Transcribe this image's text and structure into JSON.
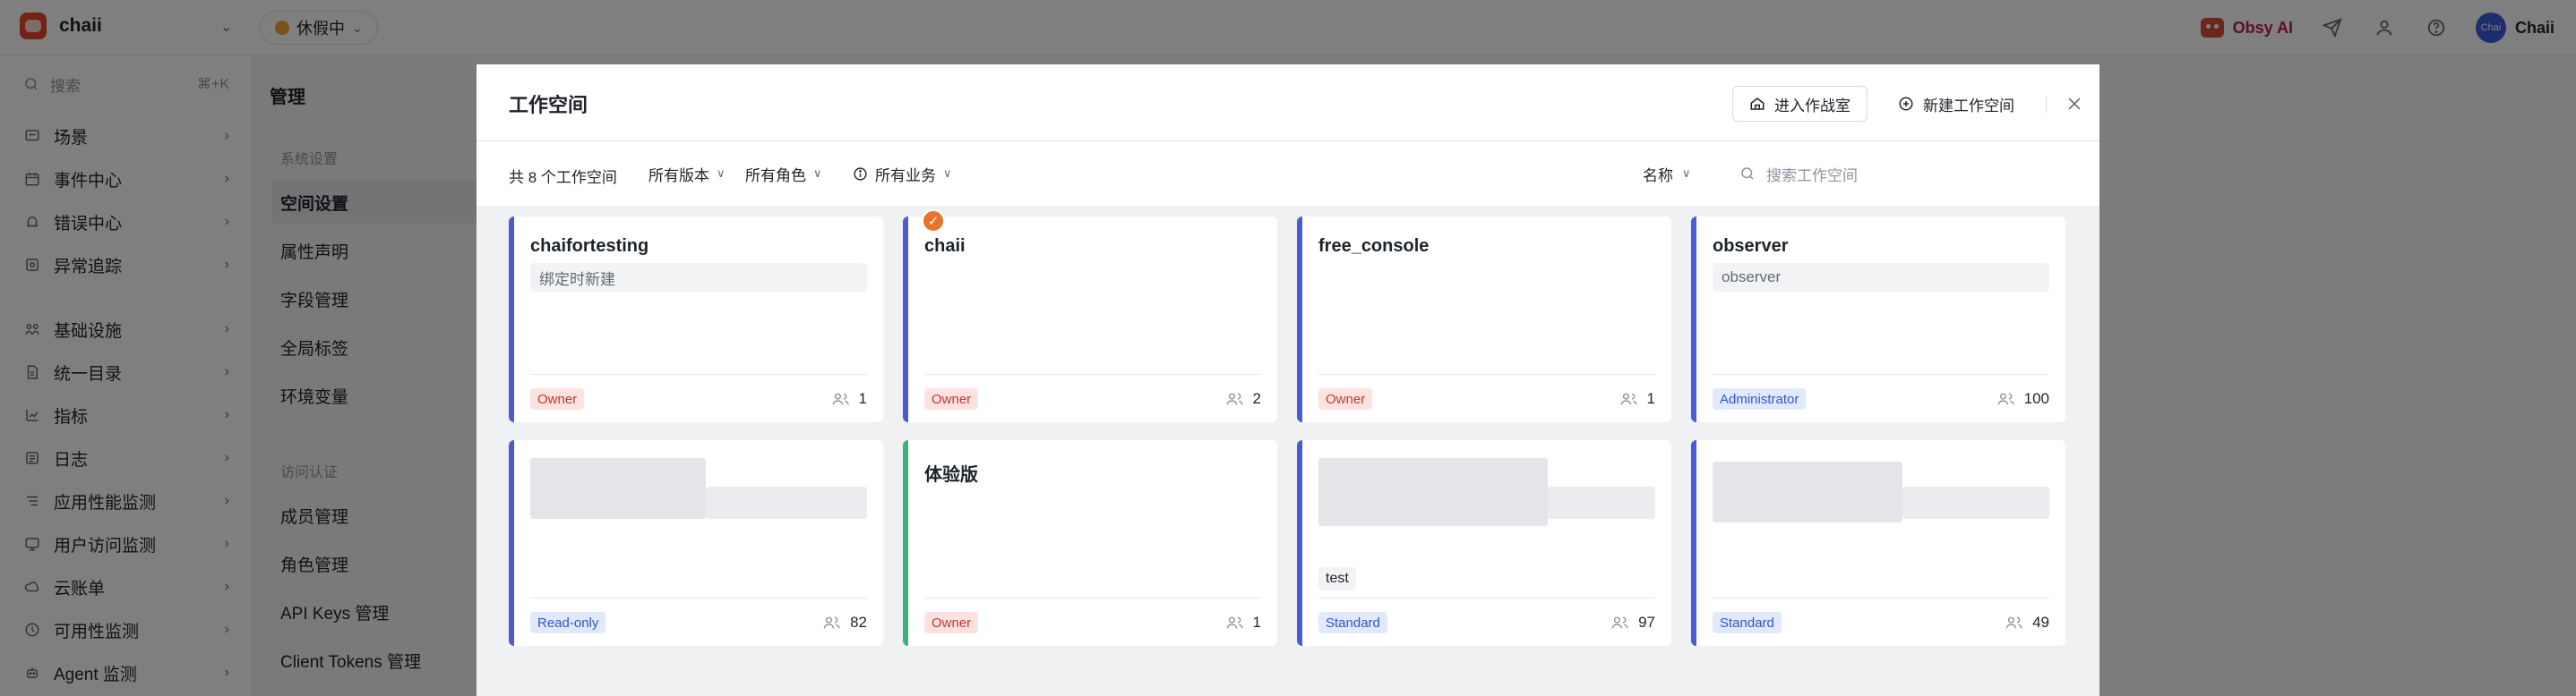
{
  "topbar": {
    "org_name": "chaii",
    "status": "休假中",
    "obsy_label": "Obsy AI",
    "user_initials": "Chai",
    "user_name": "Chaii"
  },
  "nav": {
    "search_placeholder": "搜索",
    "search_shortcut": "⌘+K",
    "items": [
      {
        "label": "场景",
        "icon": "scene-icon"
      },
      {
        "label": "事件中心",
        "icon": "event-icon"
      },
      {
        "label": "错误中心",
        "icon": "error-icon"
      },
      {
        "label": "异常追踪",
        "icon": "trace-icon"
      },
      {
        "label": "基础设施",
        "icon": "infra-icon"
      },
      {
        "label": "统一目录",
        "icon": "catalog-icon"
      },
      {
        "label": "指标",
        "icon": "metric-icon"
      },
      {
        "label": "日志",
        "icon": "log-icon"
      },
      {
        "label": "应用性能监测",
        "icon": "apm-icon"
      },
      {
        "label": "用户访问监测",
        "icon": "rum-icon"
      },
      {
        "label": "云账单",
        "icon": "cloud-bill-icon"
      },
      {
        "label": "可用性监测",
        "icon": "availability-icon"
      },
      {
        "label": "Agent 监测",
        "icon": "agent-icon"
      }
    ]
  },
  "subnav": {
    "title": "管理",
    "group1": "系统设置",
    "group1_items": [
      "空间设置",
      "属性声明",
      "字段管理",
      "全局标签",
      "环境变量"
    ],
    "group2": "访问认证",
    "group2_items": [
      "成员管理",
      "角色管理",
      "API Keys 管理",
      "Client Tokens 管理"
    ]
  },
  "modal": {
    "title": "工作空间",
    "enter_button": "进入作战室",
    "create_button": "新建工作空间",
    "count_text": "共 8 个工作空间",
    "filter_version": "所有版本",
    "filter_role": "所有角色",
    "filter_business": "所有业务",
    "sort_label": "名称",
    "search_placeholder": "搜索工作空间",
    "cards": [
      {
        "name": "chaifortesting",
        "desc": "绑定时新建",
        "role": "Owner",
        "members": "1"
      },
      {
        "name": "chaii",
        "desc": "",
        "role": "Owner",
        "members": "2"
      },
      {
        "name": "free_console",
        "desc": "",
        "role": "Owner",
        "members": "1"
      },
      {
        "name": "observer",
        "desc": "observer",
        "role": "Administrator",
        "members": "100"
      },
      {
        "name": "",
        "desc": "",
        "role": "Read-only",
        "members": "82"
      },
      {
        "name": "体验版",
        "desc": "",
        "role": "Owner",
        "members": "1"
      },
      {
        "name": "",
        "desc": "",
        "tag": "test",
        "role": "Standard",
        "members": "97"
      },
      {
        "name": "",
        "desc": "",
        "role": "Standard",
        "members": "49"
      }
    ]
  },
  "colors": {
    "accent_blue": "#4c5bd4",
    "accent_green": "#3fb07a",
    "owner_red": "#c0392b",
    "badge_orange": "#e8742c"
  }
}
